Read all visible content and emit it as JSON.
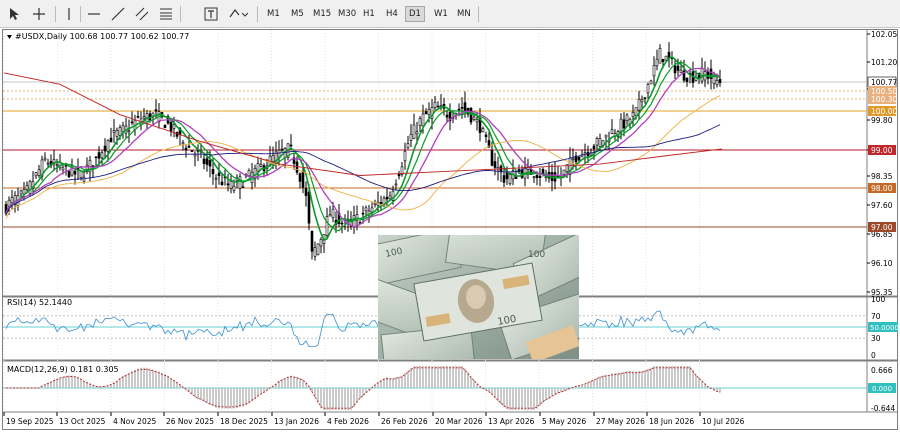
{
  "toolbar": {
    "icons": [
      "cursor-icon",
      "crosshair-icon",
      "vertical-line-icon",
      "horizontal-line-icon",
      "trend-line-icon",
      "equidistant-channel-icon",
      "fibonacci-icon",
      "text-label-icon",
      "shapes-icon"
    ],
    "timeframes": [
      "M1",
      "M5",
      "M15",
      "M30",
      "H1",
      "H4",
      "D1",
      "W1",
      "MN"
    ],
    "active_timeframe": "D1"
  },
  "chart": {
    "header": "#USDX,Daily  100.68 100.77 100.62 100.77",
    "price_ticks": [
      "102.05",
      "101.20",
      "100.35",
      "99.80",
      "99.00",
      "98.35",
      "97.60",
      "96.85",
      "96.10",
      "95.35"
    ],
    "level_labels": [
      {
        "value": "100.77",
        "color": "#ffffff",
        "text_color": "#000000"
      },
      {
        "value": "100.50",
        "color": "#e8b07e",
        "text_color": "#ffffff"
      },
      {
        "value": "100.30",
        "color": "#e8b07e",
        "text_color": "#ffffff"
      },
      {
        "value": "100.00",
        "color": "#e09a2a",
        "text_color": "#ffffff"
      },
      {
        "value": "99.00",
        "color": "#c0282c",
        "text_color": "#ffffff"
      },
      {
        "value": "98.00",
        "color": "#c56a28",
        "text_color": "#ffffff"
      },
      {
        "value": "97.00",
        "color": "#9d4a2a",
        "text_color": "#ffffff"
      }
    ],
    "date_labels": [
      "19 Sep 2025",
      "13 Oct 2025",
      "4 Nov 2025",
      "26 Nov 2025",
      "18 Dec 2025",
      "13 Jan 2026",
      "4 Feb 2026",
      "26 Feb 2026",
      "20 Mar 2026",
      "13 Apr 2026",
      "5 May 2026",
      "27 May 2026",
      "18 Jun 2026",
      "10 Jul 2026"
    ],
    "colors": {
      "line_100": "#e6a020",
      "line_99": "#b01e28",
      "line_98": "#c56a28",
      "line_97": "#9d4a2a",
      "ma_fast": "#0a9a2a",
      "ma_slow": "#b040c0",
      "ma_yellow": "#f0b040",
      "ma_navy": "#1c1c80",
      "ma_red": "#c02020"
    }
  },
  "rsi": {
    "label": "RSI(14) 52.1440",
    "ticks": [
      "100",
      "70",
      "30",
      "0"
    ],
    "level_label": "50.0000",
    "color": "#3a8fd0"
  },
  "macd": {
    "label": "MACD(12,26,9) 0.181 0.305",
    "ticks": [
      "0.666",
      "-0.644"
    ],
    "level_label": "0.000"
  }
}
